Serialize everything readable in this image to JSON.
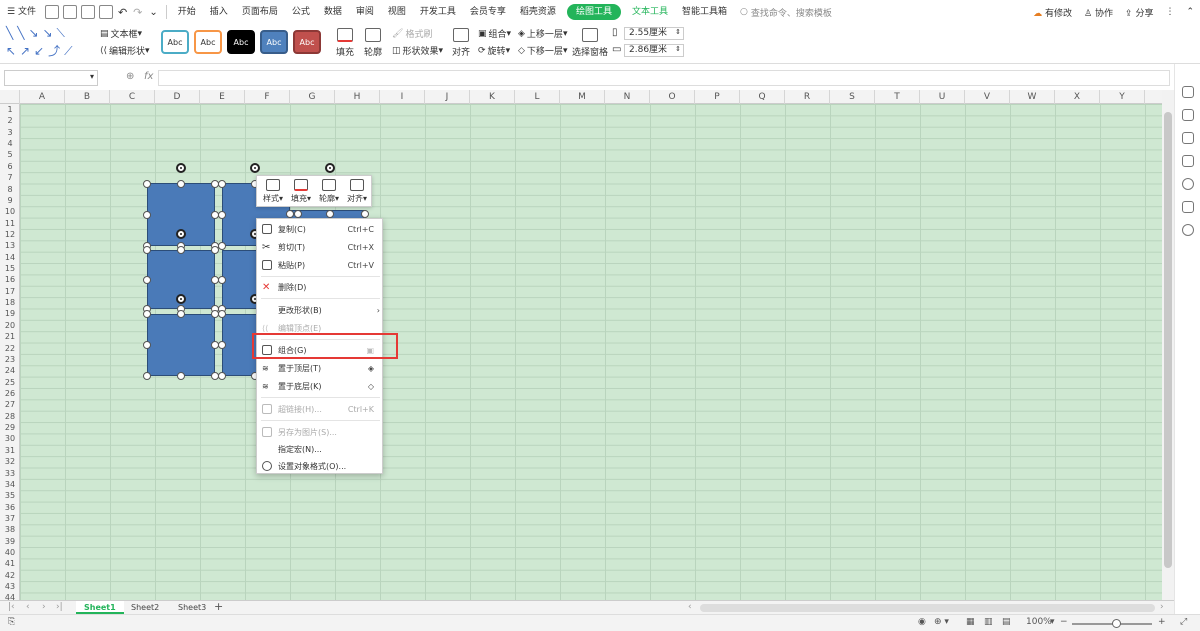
{
  "menubar": {
    "file": "文件",
    "tabs": [
      "开始",
      "插入",
      "页面布局",
      "公式",
      "数据",
      "审阅",
      "视图",
      "开发工具",
      "会员专享",
      "稻壳资源"
    ],
    "active_tab": "绘图工具",
    "text_tab": "文本工具",
    "smart_tab": "智能工具箱",
    "search": "查找命令、搜索模板",
    "modified": "有修改",
    "collab": "协作",
    "share": "分享"
  },
  "ribbon": {
    "textbox": "文本框",
    "edit_shape": "编辑形状",
    "styles": [
      {
        "label": "Abc",
        "fill": "#ffffff",
        "border": "#4bacc6",
        "text": "#333333"
      },
      {
        "label": "Abc",
        "fill": "#ffffff",
        "border": "#f79646",
        "text": "#333333"
      },
      {
        "label": "Abc",
        "fill": "#000000",
        "border": "#000000",
        "text": "#ffffff"
      },
      {
        "label": "Abc",
        "fill": "#4f81bd",
        "border": "#385d8a",
        "text": "#ffffff"
      },
      {
        "label": "Abc",
        "fill": "#c0504d",
        "border": "#8c3836",
        "text": "#ffffff"
      }
    ],
    "fill": "填充",
    "outline": "轮廓",
    "format_brush": "格式刷",
    "shape_effect": "形状效果",
    "align": "对齐",
    "group": "组合",
    "rotate": "旋转",
    "bring_forward": "上移一层",
    "send_backward": "下移一层",
    "selection_pane": "选择窗格",
    "height": "2.55厘米",
    "width": "2.86厘米"
  },
  "formula_bar": {
    "fx": "fx",
    "name_box": ""
  },
  "columns": [
    "A",
    "B",
    "C",
    "D",
    "E",
    "F",
    "G",
    "H",
    "I",
    "J",
    "K",
    "L",
    "M",
    "N",
    "O",
    "P",
    "Q",
    "R",
    "S",
    "T",
    "U",
    "V",
    "W",
    "X",
    "Y"
  ],
  "rows": [
    "1",
    "2",
    "3",
    "4",
    "5",
    "6",
    "7",
    "8",
    "9",
    "10",
    "11",
    "12",
    "13",
    "14",
    "15",
    "16",
    "17",
    "18",
    "19",
    "20",
    "21",
    "22",
    "23",
    "24",
    "25",
    "26",
    "27",
    "28",
    "29",
    "30",
    "31",
    "32",
    "33",
    "34",
    "35",
    "36",
    "37",
    "38",
    "39",
    "40",
    "41",
    "42",
    "43",
    "44"
  ],
  "mini_toolbar": [
    "样式",
    "填充",
    "轮廓",
    "对齐"
  ],
  "context_menu": [
    {
      "label": "复制(C)",
      "shortcut": "Ctrl+C",
      "disabled": false
    },
    {
      "label": "剪切(T)",
      "shortcut": "Ctrl+X",
      "disabled": false
    },
    {
      "label": "粘贴(P)",
      "shortcut": "Ctrl+V",
      "disabled": false
    },
    {
      "label": "删除(D)",
      "shortcut": "",
      "disabled": false
    },
    {
      "label": "更改形状(B)",
      "shortcut": "",
      "disabled": false
    },
    {
      "label": "编辑顶点(E)",
      "shortcut": "",
      "disabled": true
    },
    {
      "label": "组合(G)",
      "shortcut": "",
      "disabled": false
    },
    {
      "label": "置于顶层(T)",
      "shortcut": "",
      "disabled": false
    },
    {
      "label": "置于底层(K)",
      "shortcut": "",
      "disabled": false
    },
    {
      "label": "超链接(H)...",
      "shortcut": "Ctrl+K",
      "disabled": true
    },
    {
      "label": "另存为图片(S)...",
      "shortcut": "",
      "disabled": true
    },
    {
      "label": "指定宏(N)...",
      "shortcut": "",
      "disabled": false
    },
    {
      "label": "设置对象格式(O)...",
      "shortcut": "",
      "disabled": false
    }
  ],
  "sheets": [
    "Sheet1",
    "Sheet2",
    "Sheet3"
  ],
  "active_sheet": "Sheet1",
  "status": {
    "zoom": "100%"
  },
  "colors": {
    "accent": "#23b45a",
    "shape": "#4a7ab8",
    "grid_bg": "#cfe8d2",
    "highlight": "#e53935"
  }
}
